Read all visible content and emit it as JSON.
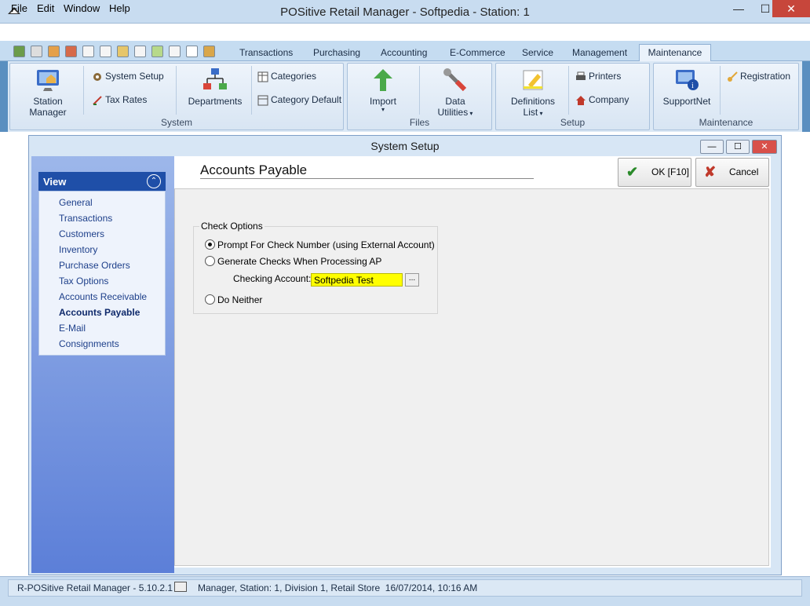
{
  "window": {
    "title": "POSitive Retail Manager - Softpedia - Station: 1",
    "controls": {
      "minimize": "—",
      "maximize": "☐",
      "close": "✕"
    }
  },
  "menu": [
    "File",
    "Edit",
    "Window",
    "Help"
  ],
  "tabs": [
    "Transactions",
    "Purchasing",
    "Accounting",
    "E-Commerce",
    "Service",
    "Management",
    "Maintenance"
  ],
  "active_tab": "Maintenance",
  "ribbon": {
    "system": {
      "label": "System",
      "station_manager": [
        "Station",
        "Manager"
      ],
      "system_setup": "System Setup",
      "tax_rates": "Tax Rates",
      "departments": "Departments",
      "categories": "Categories",
      "category_default": "Category Default"
    },
    "files": {
      "label": "Files",
      "import": "Import",
      "data_utilities": [
        "Data",
        "Utilities"
      ]
    },
    "setup": {
      "label": "Setup",
      "definitions_list": [
        "Definitions",
        "List"
      ],
      "printers": "Printers",
      "company": "Company"
    },
    "maintenance": {
      "label": "Maintenance",
      "supportnet": "SupportNet",
      "registration": "Registration"
    }
  },
  "dialog": {
    "title": "System Setup",
    "view_header": "View",
    "nav": [
      "General",
      "Transactions",
      "Customers",
      "Inventory",
      "Purchase Orders",
      "Tax Options",
      "Accounts Receivable",
      "Accounts Payable",
      "E-Mail",
      "Consignments"
    ],
    "active_nav": "Accounts Payable",
    "page_title": "Accounts Payable",
    "ok_label": "OK [F10]",
    "cancel_label": "Cancel",
    "check_options": {
      "legend": "Check Options",
      "prompt": "Prompt For Check Number (using External Account)",
      "generate": "Generate Checks When Processing AP",
      "checking_account_label": "Checking Account:",
      "checking_account_value": "Softpedia Test",
      "browse": "...",
      "neither": "Do Neither",
      "selected": "prompt"
    }
  },
  "status": {
    "app": "R-POSitive Retail Manager - 5.10.2.1",
    "info": "Manager, Station: 1, Division 1, Retail Store  16/07/2014, 10:16 AM"
  }
}
